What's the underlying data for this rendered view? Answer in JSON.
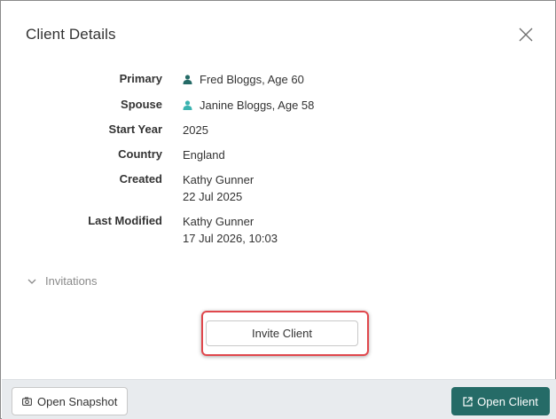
{
  "dialog": {
    "title": "Client Details",
    "close_icon": "close-icon"
  },
  "details": {
    "primary": {
      "label": "Primary",
      "value": "Fred Bloggs, Age 60",
      "icon": "person-icon",
      "icon_color": "#256b67"
    },
    "spouse": {
      "label": "Spouse",
      "value": "Janine Bloggs, Age 58",
      "icon": "person-icon",
      "icon_color": "#3bb3b0"
    },
    "start_year": {
      "label": "Start Year",
      "value": "2025"
    },
    "country": {
      "label": "Country",
      "value": "England"
    },
    "created": {
      "label": "Created",
      "by": "Kathy Gunner",
      "date": "22 Jul 2025"
    },
    "last_modified": {
      "label": "Last Modified",
      "by": "Kathy Gunner",
      "date": "17 Jul 2026, 10:03"
    }
  },
  "invitations": {
    "label": "Invitations",
    "icon": "chevron-down-icon"
  },
  "invite_button": {
    "label": "Invite Client",
    "highlight_color": "#e0474c"
  },
  "footer": {
    "snapshot_label": "Open Snapshot",
    "snapshot_icon": "camera-icon",
    "open_client_label": "Open Client",
    "open_client_icon": "external-link-icon",
    "accent_color": "#256b67"
  }
}
